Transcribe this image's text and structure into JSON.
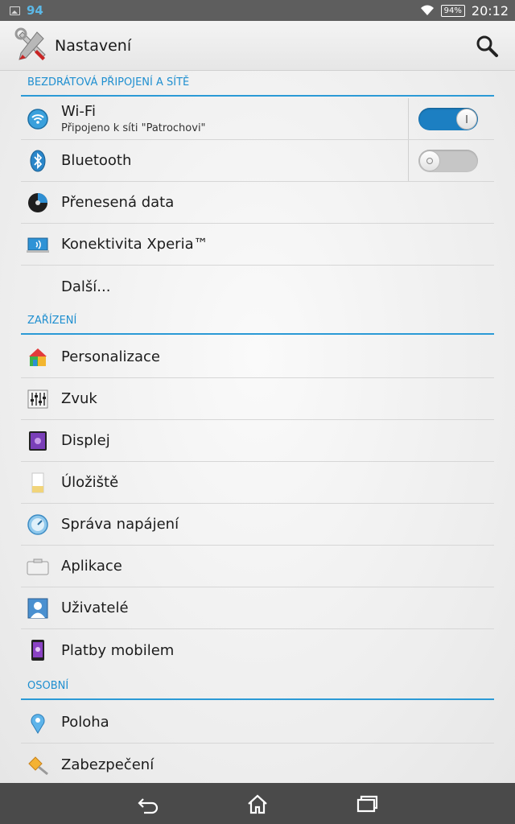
{
  "statusbar": {
    "notification_number": "94",
    "battery_percent": "94%",
    "time": "20:12"
  },
  "actionbar": {
    "title": "Nastavení"
  },
  "sections": {
    "wireless": {
      "header": "BEZDRÁTOVÁ PŘIPOJENÍ A SÍTĚ",
      "wifi": {
        "label": "Wi-Fi",
        "subtitle": "Připojeno k síti \"Patrochovi\"",
        "toggle_on": true
      },
      "bluetooth": {
        "label": "Bluetooth",
        "toggle_on": false
      },
      "data": {
        "label": "Přenesená data"
      },
      "xperia": {
        "label": "Konektivita Xperia™"
      },
      "more": {
        "label": "Další..."
      }
    },
    "device": {
      "header": "ZAŘÍZENÍ",
      "personalization": {
        "label": "Personalizace"
      },
      "sound": {
        "label": "Zvuk"
      },
      "display": {
        "label": "Displej"
      },
      "storage": {
        "label": "Úložiště"
      },
      "power": {
        "label": "Správa napájení"
      },
      "apps": {
        "label": "Aplikace"
      },
      "users": {
        "label": "Uživatelé"
      },
      "payments": {
        "label": "Platby mobilem"
      }
    },
    "personal": {
      "header": "OSOBNÍ",
      "location": {
        "label": "Poloha"
      },
      "security": {
        "label": "Zabezpečení"
      }
    }
  },
  "colors": {
    "accent": "#2b9ad6",
    "toggle_on": "#1c7fc2",
    "statusbar": "#5e5e5e",
    "navbar": "#4a4a4a"
  }
}
